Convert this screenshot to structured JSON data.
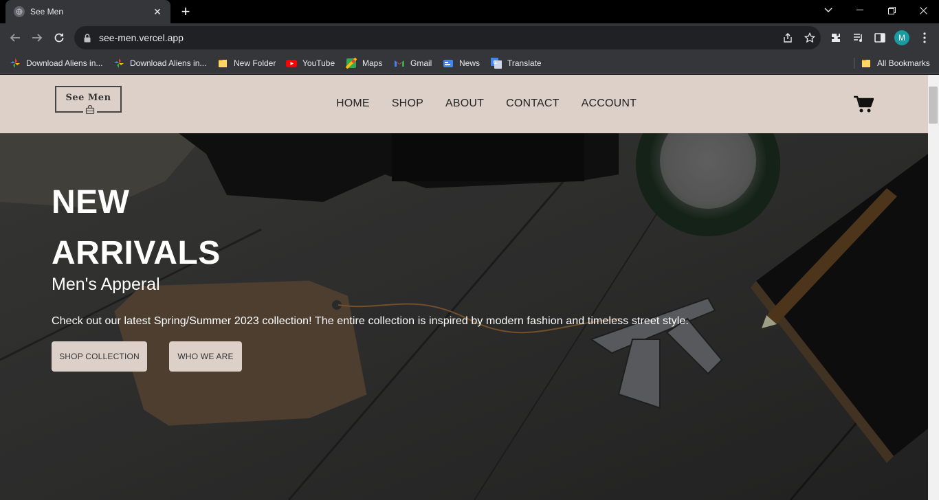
{
  "browser": {
    "tab_title": "See Men",
    "url": "see-men.vercel.app",
    "profile_initial": "M",
    "bookmarks": [
      {
        "label": "Download Aliens in...",
        "icon": "pinwheel-icon"
      },
      {
        "label": "Download Aliens in...",
        "icon": "pinwheel-icon"
      },
      {
        "label": "New Folder",
        "icon": "folder-icon"
      },
      {
        "label": "YouTube",
        "icon": "youtube-icon"
      },
      {
        "label": "Maps",
        "icon": "maps-icon"
      },
      {
        "label": "Gmail",
        "icon": "gmail-icon"
      },
      {
        "label": "News",
        "icon": "news-icon"
      },
      {
        "label": "Translate",
        "icon": "translate-icon"
      }
    ],
    "all_bookmarks": "All Bookmarks"
  },
  "site": {
    "logo_text": "See Men",
    "nav": [
      "HOME",
      "SHOP",
      "ABOUT",
      "CONTACT",
      "ACCOUNT"
    ],
    "hero": {
      "title_line1": "NEW",
      "title_line2": "ARRIVALS",
      "subtitle": "Men's Apperal",
      "description": "Check out our latest Spring/Summer 2023 collection! The entire collection is inspired by modern fashion and timeless street style.",
      "primary_button": "SHOP COLLECTION",
      "secondary_button": "WHO WE ARE"
    }
  },
  "colors": {
    "header_bg": "#ddd0c8",
    "button_bg": "#ddd0c8",
    "avatar_bg": "#1a9ba1"
  }
}
